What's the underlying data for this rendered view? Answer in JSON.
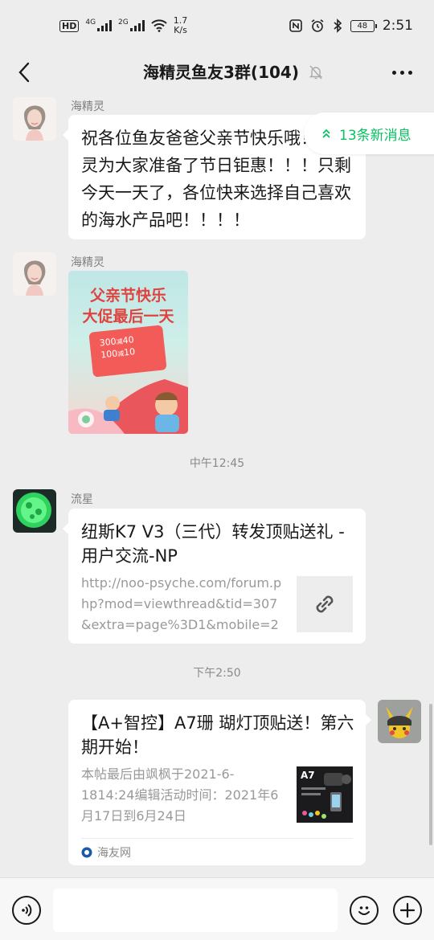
{
  "status_bar": {
    "network_1": "4G",
    "network_2": "2G",
    "hd_label": "HD",
    "speed_value": "1.7",
    "speed_unit": "K/s",
    "battery": "48",
    "time": "2:51"
  },
  "header": {
    "title": "海精灵鱼友3群(104)"
  },
  "new_messages_label": "13条新消息",
  "messages": {
    "m1_sender": "海精灵",
    "m1_text": "祝各位鱼友爸爸父亲节快乐哦！海精灵为大家准备了节日钜惠！！！只剩今天一天了，各位快来选择自己喜欢的海水产品吧！！！！",
    "m2_sender": "海精灵",
    "poster": {
      "title_1": "父亲节快乐",
      "title_2": "大促最后一天",
      "offer_1_amount": "300",
      "offer_1_sep": "减",
      "offer_1_value": "40",
      "offer_2_amount": "100",
      "offer_2_sep": "减",
      "offer_2_value": "10"
    },
    "time_1": "中午12:45",
    "m3_sender": "流星",
    "m3_title": "纽斯K7 V3（三代）转发顶贴送礼 - 用户交流-NP",
    "m3_desc": "http://noo-psyche.com/forum.php?mod=viewthread&tid=307&extra=page%3D1&mobile=2",
    "time_2": "下午2:50",
    "m4_title": "【A+智控】A7珊 瑚灯顶贴送！第六期开始！",
    "m4_desc": "本帖最后由飒枫于2021-6-1814:24编辑活动时间：2021年6月17日到6月24日",
    "m4_thumb_label": "A7",
    "m4_source": "海友网"
  },
  "colors": {
    "accent": "#07c160",
    "background": "#ededed",
    "bubble": "#ffffff"
  },
  "icons": [
    "back-arrow-icon",
    "mute-bell-icon",
    "more-icon",
    "double-chevron-up-icon",
    "link-icon",
    "voice-icon",
    "emoji-icon",
    "plus-icon"
  ]
}
